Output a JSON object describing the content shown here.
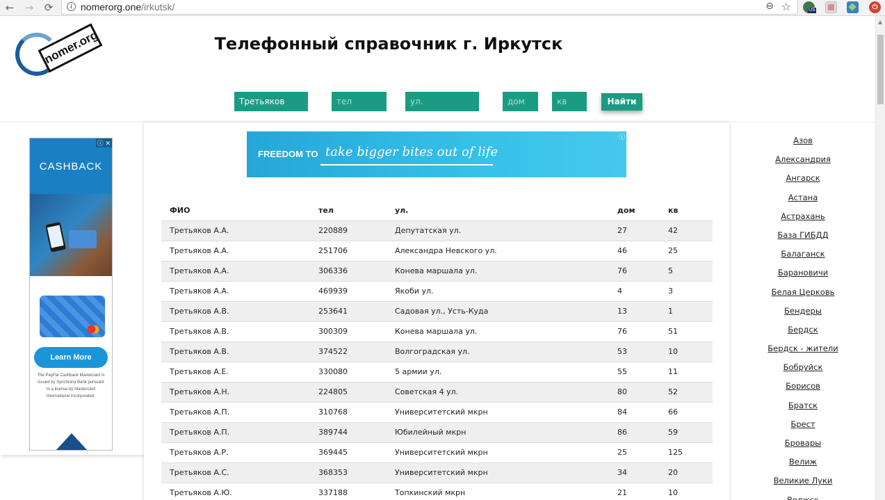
{
  "browser": {
    "url_host": "nomerorg.one",
    "url_path": "/irkutsk/",
    "ext_badge": "US",
    "nav_back": "←",
    "nav_forward": "→",
    "nav_reload": "⟳",
    "info_glyph": "i",
    "zoom_glyph": "⊖",
    "star_glyph": "☆",
    "red_ext_glyph": "⏻"
  },
  "logo": {
    "text": "nomer.org"
  },
  "page_title": "Телефонный справочник г. Иркутск",
  "search": {
    "fio_value": "Третьяков",
    "tel_placeholder": "тел",
    "street_placeholder": "ул.",
    "house_placeholder": "дом",
    "apt_placeholder": "кв",
    "submit_label": "Найти"
  },
  "ad_left": {
    "headline": "CASHBACK",
    "cta": "Learn More",
    "legal": "The PayPal Cashback Mastercard is issued by Synchrony Bank pursuant to a license by Mastercard International Incorporated.",
    "badge": "ⓘ ✕"
  },
  "ad_banner": {
    "lead": "FREEDOM TO",
    "tagline": "take bigger bites out of life",
    "badge": "ⓘ"
  },
  "table": {
    "headers": [
      "ФИО",
      "тел",
      "ул.",
      "дом",
      "кв"
    ],
    "rows": [
      [
        "Третьяков А.А.",
        "220889",
        "Депутатская ул.",
        "27",
        "42"
      ],
      [
        "Третьяков А.А.",
        "251706",
        "Александра Невского ул.",
        "46",
        "25"
      ],
      [
        "Третьяков А.А.",
        "306336",
        "Конева маршала ул.",
        "76",
        "5"
      ],
      [
        "Третьяков А.А.",
        "469939",
        "Якоби ул.",
        "4",
        "3"
      ],
      [
        "Третьяков А.В.",
        "253641",
        "Садовая ул., Усть-Куда",
        "13",
        "1"
      ],
      [
        "Третьяков А.В.",
        "300309",
        "Конева маршала ул.",
        "76",
        "51"
      ],
      [
        "Третьяков А.В.",
        "374522",
        "Волгоградская ул.",
        "53",
        "10"
      ],
      [
        "Третьяков А.Е.",
        "330080",
        "5 армии ул.",
        "55",
        "11"
      ],
      [
        "Третьяков А.Н.",
        "224805",
        "Советская 4 ул.",
        "80",
        "52"
      ],
      [
        "Третьяков А.П.",
        "310768",
        "Университетский мкрн",
        "84",
        "66"
      ],
      [
        "Третьяков А.П.",
        "389744",
        "Юбилейный мкрн",
        "86",
        "59"
      ],
      [
        "Третьяков А.Р.",
        "369445",
        "Университетский мкрн",
        "25",
        "125"
      ],
      [
        "Третьяков А.С.",
        "368353",
        "Университетский мкрн",
        "34",
        "20"
      ],
      [
        "Третьяков А.Ю.",
        "337188",
        "Топкинский мкрн",
        "21",
        "10"
      ]
    ]
  },
  "cities": [
    "Азов",
    "Александрия",
    "Ангарск",
    "Астана",
    "Астрахань",
    "База ГИБДД",
    "Балаганск",
    "Барановичи",
    "Белая Церковь",
    "Бендеры",
    "Бердск",
    "Бердск - жители",
    "Бобруйск",
    "Борисов",
    "Братск",
    "Брест",
    "Бровары",
    "Велиж",
    "Великие Луки",
    "Волжск"
  ],
  "colors": {
    "accent": "#199c83",
    "row_alt": "#efefef"
  }
}
